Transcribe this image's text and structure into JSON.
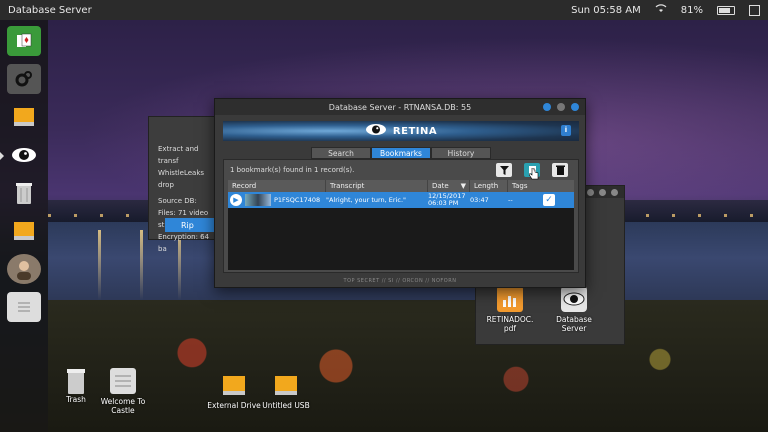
{
  "topbar": {
    "app_title": "Database Server",
    "clock": "Sun 05:58 AM",
    "battery": "81%"
  },
  "dock": {
    "items": [
      "solitaire-app",
      "settings-gears",
      "drive",
      "retina-eye",
      "trash",
      "drive-2",
      "avatar",
      "notes"
    ]
  },
  "desktop_icons": {
    "trash": "Trash",
    "welcome_l1": "Welcome To",
    "welcome_l2": "Castle",
    "external_drive": "External Drive",
    "untitled_usb": "Untitled USB",
    "retinadoc_l1": "RETINADOC.",
    "retinadoc_l2": "pdf",
    "dbserver_l1": "Database",
    "dbserver_l2": "Server"
  },
  "back_window": {
    "line1": "Extract and transf",
    "line2": "WhistleLeaks drop",
    "line3": "Source DB:",
    "line4": "Files: 71 video stre",
    "line5": "Encryption: 64 ba",
    "button": "Rip",
    "partial_label": "SA"
  },
  "main_window": {
    "title": "Database Server - RTNANSA.DB: 55",
    "brand": "RETINA",
    "info": "i",
    "tabs": [
      "Search",
      "Bookmarks",
      "History"
    ],
    "found_text": "1 bookmark(s) found in 1 record(s).",
    "columns": [
      "Record",
      "Transcript",
      "Date",
      "Length",
      "Tags"
    ],
    "date_sort_arrow": "▼",
    "rows": [
      {
        "record": "P1FSQC17408",
        "transcript": "\"Alright, your turn, Eric.\"",
        "date_l1": "12/15/2017",
        "date_l2": "06:03 PM",
        "length": "03:47",
        "tags": "--"
      }
    ],
    "footer": "TOP SECRET // SI // ORCON // NOFORN"
  },
  "colors": {
    "accent": "#2f86d8",
    "bookmark_active": "#2aa0b0"
  }
}
